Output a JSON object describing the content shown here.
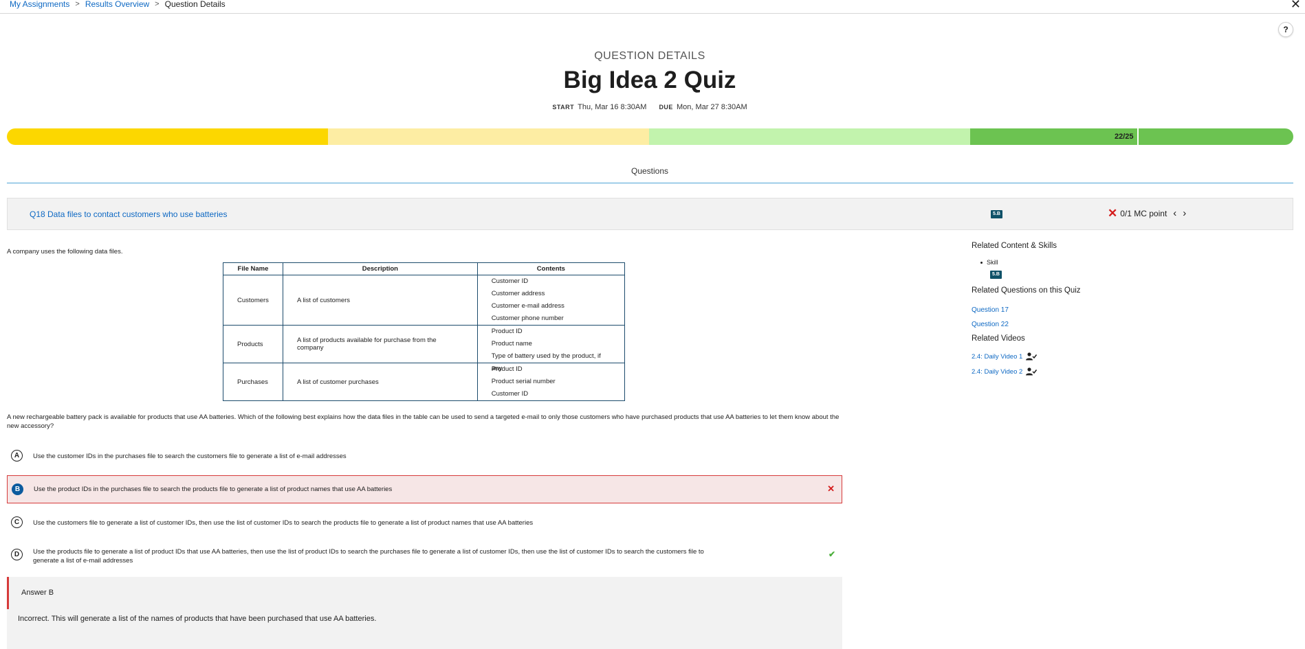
{
  "breadcrumb": {
    "items": [
      "My Assignments",
      "Results Overview"
    ],
    "current": "Question Details",
    "separator": ">"
  },
  "header": {
    "eyebrow": "QUESTION DETAILS",
    "title": "Big Idea 2 Quiz",
    "start_label": "START",
    "start_value": "Thu, Mar 16 8:30AM",
    "due_label": "DUE",
    "due_value": "Mon, Mar 27 8:30AM"
  },
  "score_bar": {
    "score_text": "22/25",
    "score": 22,
    "max": 25,
    "colors": [
      "#fcd700",
      "#fdeda3",
      "#c2f3ad",
      "#6cc351"
    ]
  },
  "tabs": {
    "active": "Questions"
  },
  "question": {
    "title": "Q18 Data files to contact customers who use batteries",
    "skill_badge": "5.B",
    "result": "0/1 MC point",
    "stem_intro": "A company uses the following data files.",
    "table": {
      "headers": [
        "File Name",
        "Description",
        "Contents"
      ],
      "rows": [
        {
          "name": "Customers",
          "description": "A list of customers",
          "contents": [
            "Customer ID",
            "Customer address",
            "Customer e-mail address",
            "Customer phone number"
          ]
        },
        {
          "name": "Products",
          "description": "A list of products available for purchase from the company",
          "contents": [
            "Product ID",
            "Product name",
            "Type of battery used by the product, if any"
          ]
        },
        {
          "name": "Purchases",
          "description": "A list of customer purchases",
          "contents": [
            "Product ID",
            "Product serial number",
            "Customer ID"
          ]
        }
      ]
    },
    "stem_question": "A new rechargeable battery pack is available for products that use AA batteries. Which of the following best explains how the data files in the table can be used to send a targeted e-mail to only those customers who have purchased products that use AA batteries to let them know about the new accessory?",
    "options": [
      {
        "letter": "A",
        "text": "Use the customer IDs in the purchases file to search the customers file to generate a list of e-mail addresses"
      },
      {
        "letter": "B",
        "text": "Use the product IDs in the purchases file to search the products file to generate a list of product names that use AA batteries",
        "state": "selected-incorrect"
      },
      {
        "letter": "C",
        "text": "Use the customers file to generate a list of customer IDs, then use the list of customer IDs to search the products file to generate a list of product names that use AA batteries"
      },
      {
        "letter": "D",
        "text": "Use the products file to generate a list of product IDs that use AA batteries, then use the list of product IDs to search the purchases file to generate a list of customer IDs, then use the list of customer IDs to search the customers file to generate a list of e-mail addresses",
        "state": "correct"
      }
    ],
    "answer": {
      "title": "Answer B",
      "explanation": "Incorrect. This will generate a list of the names of products that have been purchased that use AA batteries."
    }
  },
  "sidebar": {
    "related_content_title": "Related Content & Skills",
    "skill_label": "Skill",
    "skill_badge": "5.B",
    "related_questions_title": "Related Questions on this Quiz",
    "related_questions": [
      "Question 17",
      "Question 22"
    ],
    "related_videos_title": "Related Videos",
    "related_videos": [
      "2.4: Daily Video 1",
      "2.4: Daily Video 2"
    ]
  },
  "colors": {
    "link": "#0d68c3",
    "incorrect": "#d41c1c",
    "correct": "#4caf3c",
    "badge": "#0f5168",
    "tab_rule": "#4da3d6"
  }
}
